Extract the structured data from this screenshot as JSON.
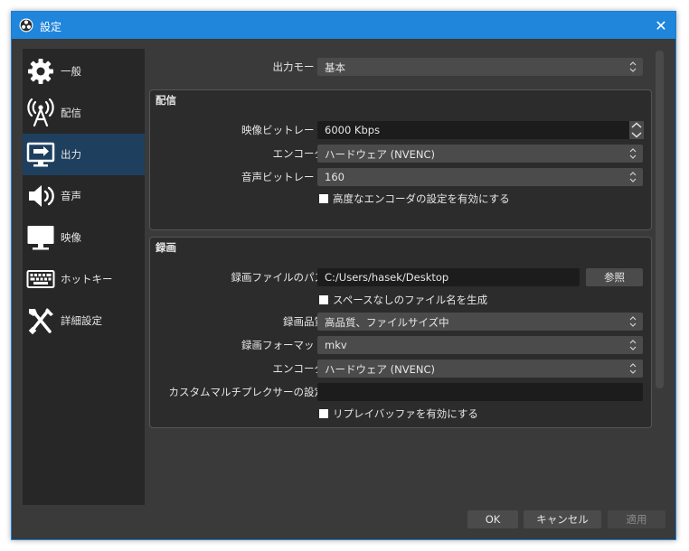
{
  "window": {
    "title": "設定"
  },
  "sidebar": {
    "items": [
      {
        "label": "一般",
        "icon": "gear-icon"
      },
      {
        "label": "配信",
        "icon": "broadcast-antenna-icon"
      },
      {
        "label": "出力",
        "icon": "monitor-output-icon",
        "active": true
      },
      {
        "label": "音声",
        "icon": "speaker-icon"
      },
      {
        "label": "映像",
        "icon": "monitor-icon"
      },
      {
        "label": "ホットキー",
        "icon": "keyboard-icon"
      },
      {
        "label": "詳細設定",
        "icon": "wrench-screwdriver-icon"
      }
    ]
  },
  "output": {
    "mode_label": "出力モード",
    "mode_value": "基本"
  },
  "streaming": {
    "title": "配信",
    "video_bitrate_label": "映像ビットレート",
    "video_bitrate_value": "6000 Kbps",
    "encoder_label": "エンコーダ",
    "encoder_value": "ハードウェア (NVENC)",
    "audio_bitrate_label": "音声ビットレート",
    "audio_bitrate_value": "160",
    "advanced_label": "高度なエンコーダの設定を有効にする"
  },
  "recording": {
    "title": "録画",
    "path_label": "録画ファイルのパス",
    "path_value": "C:/Users/hasek/Desktop",
    "browse_label": "参照",
    "nospace_label": "スペースなしのファイル名を生成",
    "quality_label": "録画品質",
    "quality_value": "高品質、ファイルサイズ中",
    "format_label": "録画フォーマット",
    "format_value": "mkv",
    "encoder_label": "エンコーダ",
    "encoder_value": "ハードウェア (NVENC)",
    "muxer_label": "カスタムマルチプレクサーの設定",
    "muxer_value": "",
    "replay_label": "リプレイバッファを有効にする"
  },
  "buttons": {
    "ok": "OK",
    "cancel": "キャンセル",
    "apply": "適用"
  },
  "colors": {
    "accent": "#1f86dc",
    "background": "#3a3a3a",
    "sidebar": "#272727",
    "selected": "#1e3f5e"
  }
}
